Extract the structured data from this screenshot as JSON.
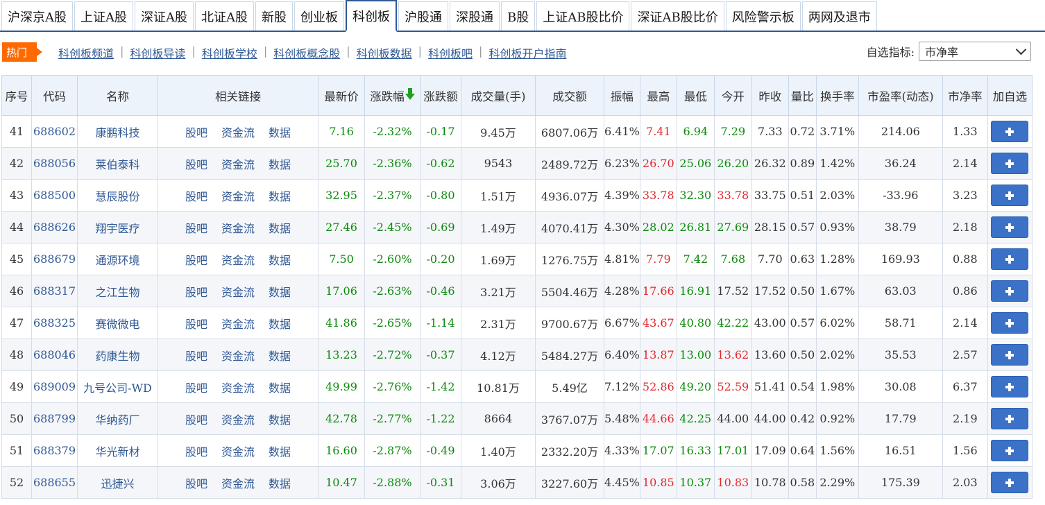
{
  "tabs": [
    "沪深京A股",
    "上证A股",
    "深证A股",
    "北证A股",
    "新股",
    "创业板",
    "科创板",
    "沪股通",
    "深股通",
    "B股",
    "上证AB股比价",
    "深证AB股比价",
    "风险警示板",
    "两网及退市"
  ],
  "active_tab": 6,
  "hot": {
    "badge": "热门",
    "links": [
      "科创板频道",
      "科创板导读",
      "科创板学校",
      "科创板概念股",
      "科创板数据",
      "科创板吧",
      "科创板开户指南"
    ],
    "separator": "|"
  },
  "selector": {
    "label": "自选指标:",
    "value": "市净率"
  },
  "table": {
    "headers": [
      "序号",
      "代码",
      "名称",
      "相关链接",
      "最新价",
      "涨跌幅",
      "涨跌额",
      "成交量(手)",
      "成交额",
      "振幅",
      "最高",
      "最低",
      "今开",
      "昨收",
      "量比",
      "换手率",
      "市盈率(动态)",
      "市净率",
      "加自选"
    ],
    "sort_indicator": "down-arrow-icon",
    "link_labels": [
      "股吧",
      "资金流",
      "数据"
    ],
    "colors": {
      "up": "#e3262c",
      "down": "#0b8a0b",
      "link": "#2f5895",
      "header_bg": "#edf3fa",
      "button": "#3b72c8"
    },
    "rows": [
      {
        "no": "41",
        "code": "688602",
        "name": "康鹏科技",
        "price": "7.16",
        "pct": "-2.32%",
        "chg": "-0.17",
        "vol": "9.45万",
        "amt": "6807.06万",
        "amp": "6.41%",
        "high": "7.41",
        "low": "6.94",
        "open": "7.29",
        "prev": "7.33",
        "vr": "0.72",
        "turn": "3.71%",
        "pe": "214.06",
        "pb": "1.33",
        "c_high": "red",
        "c_low": "green",
        "c_open": "green"
      },
      {
        "no": "42",
        "code": "688056",
        "name": "莱伯泰科",
        "price": "25.70",
        "pct": "-2.36%",
        "chg": "-0.62",
        "vol": "9543",
        "amt": "2489.72万",
        "amp": "6.23%",
        "high": "26.70",
        "low": "25.06",
        "open": "26.20",
        "prev": "26.32",
        "vr": "0.89",
        "turn": "1.42%",
        "pe": "36.24",
        "pb": "2.14",
        "c_high": "red",
        "c_low": "green",
        "c_open": "green"
      },
      {
        "no": "43",
        "code": "688500",
        "name": "慧辰股份",
        "price": "32.95",
        "pct": "-2.37%",
        "chg": "-0.80",
        "vol": "1.51万",
        "amt": "4936.07万",
        "amp": "4.39%",
        "high": "33.78",
        "low": "32.30",
        "open": "33.78",
        "prev": "33.75",
        "vr": "0.51",
        "turn": "2.03%",
        "pe": "-33.96",
        "pb": "3.23",
        "c_high": "red",
        "c_low": "green",
        "c_open": "red"
      },
      {
        "no": "44",
        "code": "688626",
        "name": "翔宇医疗",
        "price": "27.46",
        "pct": "-2.45%",
        "chg": "-0.69",
        "vol": "1.49万",
        "amt": "4070.41万",
        "amp": "4.30%",
        "high": "28.02",
        "low": "26.81",
        "open": "27.69",
        "prev": "28.15",
        "vr": "0.57",
        "turn": "0.93%",
        "pe": "38.79",
        "pb": "2.18",
        "c_high": "green",
        "c_low": "green",
        "c_open": "green"
      },
      {
        "no": "45",
        "code": "688679",
        "name": "通源环境",
        "price": "7.50",
        "pct": "-2.60%",
        "chg": "-0.20",
        "vol": "1.69万",
        "amt": "1276.75万",
        "amp": "4.81%",
        "high": "7.79",
        "low": "7.42",
        "open": "7.68",
        "prev": "7.70",
        "vr": "0.63",
        "turn": "1.28%",
        "pe": "169.93",
        "pb": "0.88",
        "c_high": "red",
        "c_low": "green",
        "c_open": "green"
      },
      {
        "no": "46",
        "code": "688317",
        "name": "之江生物",
        "price": "17.06",
        "pct": "-2.63%",
        "chg": "-0.46",
        "vol": "3.21万",
        "amt": "5504.46万",
        "amp": "4.28%",
        "high": "17.66",
        "low": "16.91",
        "open": "17.52",
        "prev": "17.52",
        "vr": "0.50",
        "turn": "1.67%",
        "pe": "63.03",
        "pb": "0.86",
        "c_high": "red",
        "c_low": "green",
        "c_open": "plain"
      },
      {
        "no": "47",
        "code": "688325",
        "name": "赛微微电",
        "price": "41.86",
        "pct": "-2.65%",
        "chg": "-1.14",
        "vol": "2.31万",
        "amt": "9700.67万",
        "amp": "6.67%",
        "high": "43.67",
        "low": "40.80",
        "open": "42.22",
        "prev": "43.00",
        "vr": "0.57",
        "turn": "6.02%",
        "pe": "58.71",
        "pb": "2.14",
        "c_high": "red",
        "c_low": "green",
        "c_open": "green"
      },
      {
        "no": "48",
        "code": "688046",
        "name": "药康生物",
        "price": "13.23",
        "pct": "-2.72%",
        "chg": "-0.37",
        "vol": "4.12万",
        "amt": "5484.27万",
        "amp": "6.40%",
        "high": "13.87",
        "low": "13.00",
        "open": "13.62",
        "prev": "13.60",
        "vr": "0.50",
        "turn": "2.02%",
        "pe": "35.53",
        "pb": "2.57",
        "c_high": "red",
        "c_low": "green",
        "c_open": "red"
      },
      {
        "no": "49",
        "code": "689009",
        "name": "九号公司-WD",
        "price": "49.99",
        "pct": "-2.76%",
        "chg": "-1.42",
        "vol": "10.81万",
        "amt": "5.49亿",
        "amp": "7.12%",
        "high": "52.86",
        "low": "49.20",
        "open": "52.59",
        "prev": "51.41",
        "vr": "0.54",
        "turn": "1.98%",
        "pe": "30.08",
        "pb": "6.37",
        "c_high": "red",
        "c_low": "green",
        "c_open": "red"
      },
      {
        "no": "50",
        "code": "688799",
        "name": "华纳药厂",
        "price": "42.78",
        "pct": "-2.77%",
        "chg": "-1.22",
        "vol": "8664",
        "amt": "3767.07万",
        "amp": "5.48%",
        "high": "44.66",
        "low": "42.25",
        "open": "44.00",
        "prev": "44.00",
        "vr": "0.42",
        "turn": "0.92%",
        "pe": "17.79",
        "pb": "2.19",
        "c_high": "red",
        "c_low": "green",
        "c_open": "plain"
      },
      {
        "no": "51",
        "code": "688379",
        "name": "华光新材",
        "price": "16.60",
        "pct": "-2.87%",
        "chg": "-0.49",
        "vol": "1.40万",
        "amt": "2332.20万",
        "amp": "4.33%",
        "high": "17.07",
        "low": "16.33",
        "open": "17.01",
        "prev": "17.09",
        "vr": "0.64",
        "turn": "1.56%",
        "pe": "16.51",
        "pb": "1.56",
        "c_high": "green",
        "c_low": "green",
        "c_open": "green"
      },
      {
        "no": "52",
        "code": "688655",
        "name": "迅捷兴",
        "price": "10.47",
        "pct": "-2.88%",
        "chg": "-0.31",
        "vol": "3.06万",
        "amt": "3227.60万",
        "amp": "4.45%",
        "high": "10.85",
        "low": "10.37",
        "open": "10.83",
        "prev": "10.78",
        "vr": "0.58",
        "turn": "2.29%",
        "pe": "175.39",
        "pb": "2.03",
        "c_high": "red",
        "c_low": "green",
        "c_open": "red"
      }
    ]
  }
}
